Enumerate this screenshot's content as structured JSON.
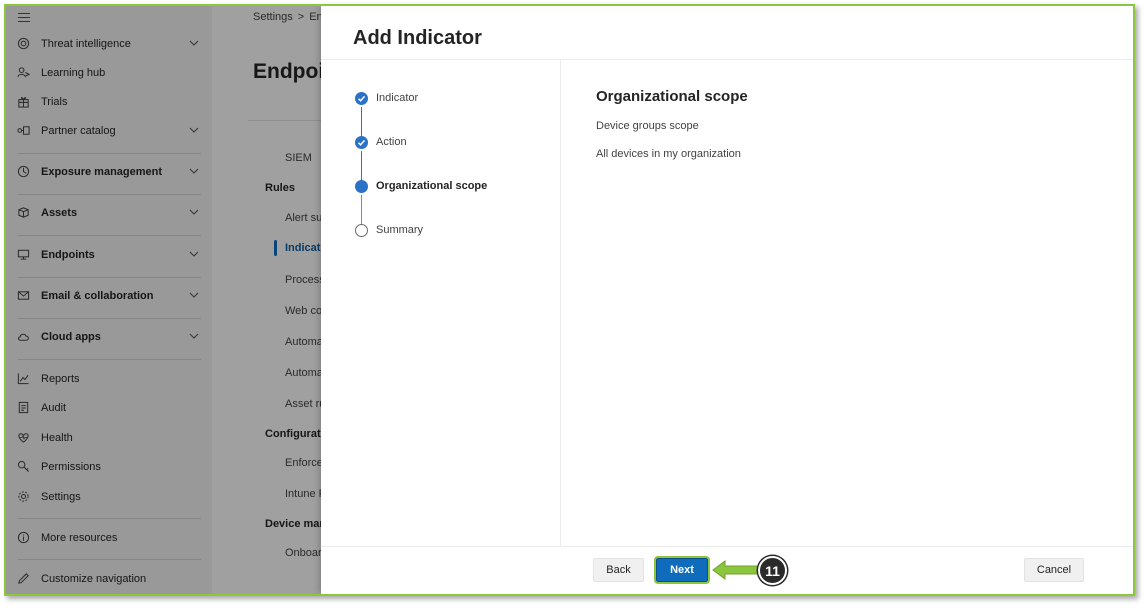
{
  "sidebar": {
    "items": [
      {
        "label": "Threat intelligence",
        "icon": "threat-intel-icon",
        "chevron": true,
        "bold": false
      },
      {
        "label": "Learning hub",
        "icon": "learning-hub-icon",
        "chevron": false,
        "bold": false
      },
      {
        "label": "Trials",
        "icon": "gift-icon",
        "chevron": false,
        "bold": false
      },
      {
        "label": "Partner catalog",
        "icon": "partner-icon",
        "chevron": true,
        "bold": false
      },
      {
        "label": "Exposure management",
        "icon": "exposure-icon",
        "chevron": true,
        "bold": true
      },
      {
        "label": "Assets",
        "icon": "assets-icon",
        "chevron": true,
        "bold": true
      },
      {
        "label": "Endpoints",
        "icon": "endpoints-icon",
        "chevron": true,
        "bold": true
      },
      {
        "label": "Email & collaboration",
        "icon": "mail-icon",
        "chevron": true,
        "bold": true
      },
      {
        "label": "Cloud apps",
        "icon": "cloud-icon",
        "chevron": true,
        "bold": true
      },
      {
        "label": "Reports",
        "icon": "chart-icon",
        "chevron": false,
        "bold": false
      },
      {
        "label": "Audit",
        "icon": "audit-icon",
        "chevron": false,
        "bold": false
      },
      {
        "label": "Health",
        "icon": "heart-icon",
        "chevron": false,
        "bold": false
      },
      {
        "label": "Permissions",
        "icon": "key-icon",
        "chevron": false,
        "bold": false
      },
      {
        "label": "Settings",
        "icon": "gear-icon",
        "chevron": false,
        "bold": false
      },
      {
        "label": "More resources",
        "icon": "info-icon",
        "chevron": false,
        "bold": false
      },
      {
        "label": "Customize navigation",
        "icon": "pencil-icon",
        "chevron": false,
        "bold": false
      }
    ]
  },
  "background": {
    "breadcrumb": [
      "Settings",
      "En"
    ],
    "title": "Endpoi",
    "items": [
      "SIEM",
      "Rules",
      "Alert su",
      "Indicato",
      "Process",
      "Web co",
      "Automa",
      "Automa",
      "Asset ru",
      "Configurati",
      "Enforce",
      "Intune F",
      "Device man",
      "Onboar"
    ]
  },
  "panel": {
    "title": "Add Indicator",
    "steps": [
      {
        "label": "Indicator",
        "state": "done"
      },
      {
        "label": "Action",
        "state": "done"
      },
      {
        "label": "Organizational scope",
        "state": "current"
      },
      {
        "label": "Summary",
        "state": "todo"
      }
    ],
    "section": {
      "title": "Organizational scope",
      "subtitle": "Device groups scope",
      "value": "All devices in my organization"
    },
    "buttons": {
      "back": "Back",
      "next": "Next",
      "cancel": "Cancel"
    }
  },
  "annotation": {
    "step_number": "11",
    "color": "#8cc63f"
  }
}
